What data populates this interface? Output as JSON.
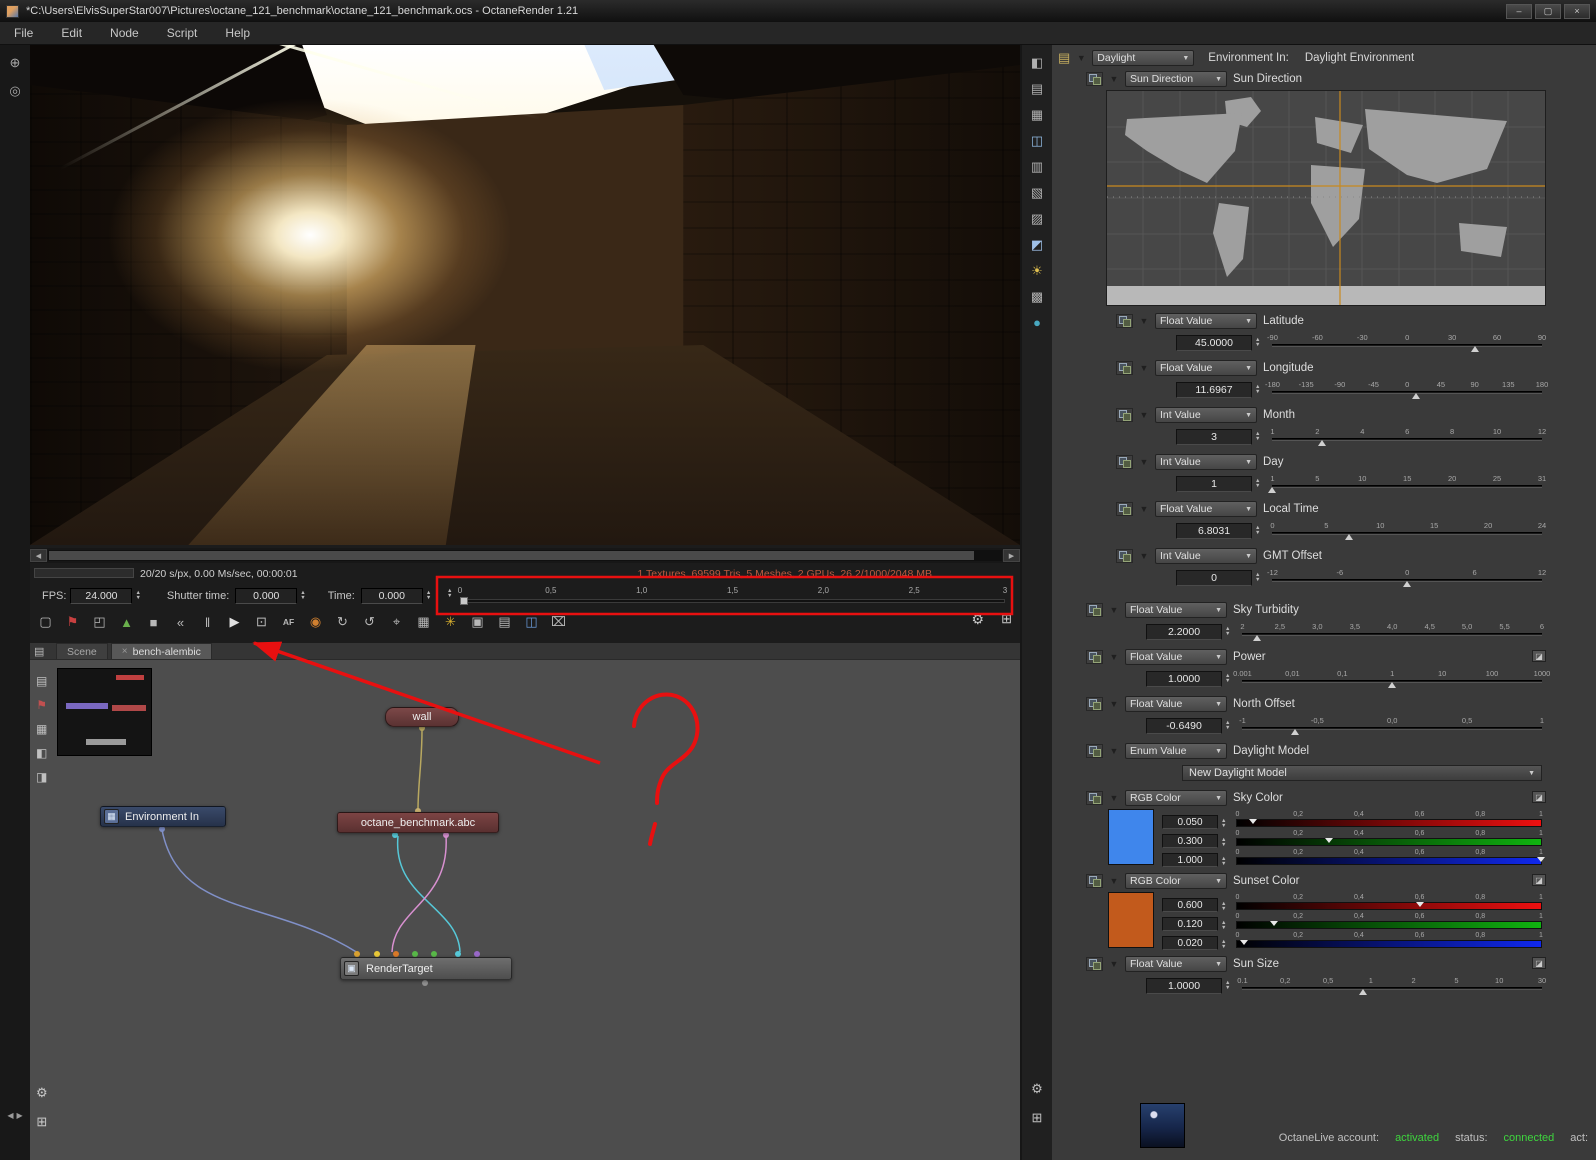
{
  "window": {
    "title": "*C:\\Users\\ElvisSuperStar007\\Pictures\\octane_121_benchmark\\octane_121_benchmark.ocs - OctaneRender 1.21",
    "buttons": {
      "minimize": "–",
      "maximize": "▢",
      "close": "×"
    },
    "menus": [
      "File",
      "Edit",
      "Node",
      "Script",
      "Help"
    ]
  },
  "left_toolbar": [
    {
      "name": "target-icon",
      "glyph": "⊕"
    },
    {
      "name": "zoom-tool-icon",
      "glyph": "◎"
    }
  ],
  "viewport": {
    "stats_left": "20/20 s/px, 0.00 Ms/sec, 00:00:01",
    "stats_right": "1 Textures, 69599 Tris, 5 Meshes, 2 GPUs, 26.2/1000/2048 MB"
  },
  "playback": {
    "fps_label": "FPS:",
    "fps_value": "24.000",
    "shutter_label": "Shutter time:",
    "shutter_value": "0.000",
    "time_label": "Time:",
    "time_value": "0.000",
    "timeline_ticks": [
      "0",
      "0,5",
      "1,0",
      "1,5",
      "2,0",
      "2,5",
      "3"
    ]
  },
  "toolbar": [
    {
      "name": "save-image-icon",
      "glyph": "▢"
    },
    {
      "name": "language-flag-icon",
      "glyph": "⚑",
      "color": "#c84040"
    },
    {
      "name": "fit-view-icon",
      "glyph": "◰"
    },
    {
      "name": "render-restart-icon",
      "glyph": "▲",
      "color": "#6ab04c"
    },
    {
      "name": "stop-icon",
      "glyph": "■"
    },
    {
      "name": "rewind-icon",
      "glyph": "«"
    },
    {
      "name": "pause-icon",
      "glyph": "‖"
    },
    {
      "name": "play-icon",
      "glyph": "▶",
      "color": "#e0e0e0"
    },
    {
      "name": "display-icon",
      "glyph": "⊡"
    },
    {
      "name": "af-toggle-icon",
      "glyph": "AF",
      "text": true
    },
    {
      "name": "globe-icon",
      "glyph": "◉",
      "color": "#d08030"
    },
    {
      "name": "refresh-icon",
      "glyph": "↻"
    },
    {
      "name": "reset-icon",
      "glyph": "↺"
    },
    {
      "name": "focus-pick-icon",
      "glyph": "⌖"
    },
    {
      "name": "grid-icon",
      "glyph": "▦"
    },
    {
      "name": "effects-icon",
      "glyph": "✳",
      "color": "#d8b030"
    },
    {
      "name": "copy-icon",
      "glyph": "▣"
    },
    {
      "name": "paste-icon",
      "glyph": "▤"
    },
    {
      "name": "image-icon",
      "glyph": "◫",
      "color": "#6a9ad8"
    },
    {
      "name": "delete-icon",
      "glyph": "⌧"
    }
  ],
  "node_graph": {
    "tabs": [
      {
        "label": "Scene"
      },
      {
        "label": "bench-alembic"
      }
    ],
    "side_icons": [
      {
        "name": "overview-icon",
        "glyph": "▤"
      },
      {
        "name": "flag-icon",
        "glyph": "⚑",
        "color": "#c05050"
      },
      {
        "name": "layers-icon",
        "glyph": "▦"
      },
      {
        "name": "group-icon",
        "glyph": "◧"
      },
      {
        "name": "ungroup-icon",
        "glyph": "◨"
      }
    ],
    "nodes": [
      {
        "label": "wall"
      },
      {
        "label": "octane_benchmark.abc"
      },
      {
        "label": "Environment In"
      },
      {
        "label": "RenderTarget"
      }
    ]
  },
  "mid_toolbar": [
    {
      "name": "screenshot-icon",
      "glyph": "◧"
    },
    {
      "name": "clipboard-icon",
      "glyph": "▤"
    },
    {
      "name": "film-icon",
      "glyph": "▦"
    },
    {
      "name": "gallery-icon",
      "glyph": "◫",
      "color": "#8fb8e0"
    },
    {
      "name": "mesh-icon",
      "glyph": "▥"
    },
    {
      "name": "materials-icon",
      "glyph": "▧"
    },
    {
      "name": "texture-icon",
      "glyph": "▨"
    },
    {
      "name": "image-icon",
      "glyph": "◩",
      "color": "#9fc0e8"
    },
    {
      "name": "environment-icon",
      "glyph": "☀",
      "color": "#e0c050"
    },
    {
      "name": "checker-icon",
      "glyph": "▩"
    },
    {
      "name": "paint-icon",
      "glyph": "●",
      "color": "#48a8c0"
    }
  ],
  "right_panel": {
    "header": {
      "dropdown": "Daylight",
      "env_label": "Environment In:",
      "env_value": "Daylight Environment"
    },
    "sun_direction": {
      "dropdown": "Sun Direction",
      "label": "Sun Direction"
    },
    "params": [
      {
        "kind": "float",
        "type_label": "Float Value",
        "label": "Latitude",
        "value": "45.0000",
        "indent": true,
        "pos": 0.75,
        "ticks": [
          "-90",
          "-60",
          "-30",
          "0",
          "30",
          "60",
          "90"
        ]
      },
      {
        "kind": "float",
        "type_label": "Float Value",
        "label": "Longitude",
        "value": "11.6967",
        "indent": true,
        "pos": 0.533,
        "ticks": [
          "-180",
          "-135",
          "-90",
          "-45",
          "0",
          "45",
          "90",
          "135",
          "180"
        ]
      },
      {
        "kind": "float",
        "type_label": "Int Value",
        "label": "Month",
        "value": "3",
        "indent": true,
        "pos": 0.182,
        "ticks": [
          "1",
          "2",
          "4",
          "6",
          "8",
          "10",
          "12"
        ]
      },
      {
        "kind": "float",
        "type_label": "Int Value",
        "label": "Day",
        "value": "1",
        "indent": true,
        "pos": 0.0,
        "ticks": [
          "1",
          "5",
          "10",
          "15",
          "20",
          "25",
          "31"
        ]
      },
      {
        "kind": "float",
        "type_label": "Float Value",
        "label": "Local Time",
        "value": "6.8031",
        "indent": true,
        "pos": 0.283,
        "ticks": [
          "0",
          "5",
          "10",
          "15",
          "20",
          "24"
        ]
      },
      {
        "kind": "float",
        "type_label": "Int Value",
        "label": "GMT Offset",
        "value": "0",
        "indent": true,
        "pos": 0.5,
        "gap_after": true,
        "ticks": [
          "-12",
          "-6",
          "0",
          "6",
          "12"
        ]
      },
      {
        "kind": "float",
        "type_label": "Float Value",
        "label": "Sky Turbidity",
        "value": "2.2000",
        "pos": 0.05,
        "ticks": [
          "2",
          "2,5",
          "3,0",
          "3,5",
          "4,0",
          "4,5",
          "5,0",
          "5,5",
          "6"
        ]
      },
      {
        "kind": "float",
        "type_label": "Float Value",
        "label": "Power",
        "value": "1.0000",
        "pos": 0.5,
        "right_icon": true,
        "ticks": [
          "0.001",
          "0,01",
          "0,1",
          "1",
          "10",
          "100",
          "1000"
        ]
      },
      {
        "kind": "float",
        "type_label": "Float Value",
        "label": "North Offset",
        "value": "-0.6490",
        "pos": 0.176,
        "ticks": [
          "-1",
          "-0,5",
          "0,0",
          "0,5",
          "1"
        ]
      },
      {
        "kind": "enum",
        "type_label": "Enum Value",
        "label": "Daylight Model",
        "value": "New Daylight Model"
      },
      {
        "kind": "rgb",
        "type_label": "RGB Color",
        "label": "Sky Color",
        "swatch": "#3f86ec",
        "right_icon": true,
        "ticks": [
          "0",
          "0,2",
          "0,4",
          "0,6",
          "0,8",
          "1"
        ],
        "channels": [
          {
            "value": "0.050",
            "pos": 0.05
          },
          {
            "value": "0.300",
            "pos": 0.3
          },
          {
            "value": "1.000",
            "pos": 1.0
          }
        ]
      },
      {
        "kind": "rgb",
        "type_label": "RGB Color",
        "label": "Sunset Color",
        "swatch": "#c25a1c",
        "right_icon": true,
        "ticks": [
          "0",
          "0,2",
          "0,4",
          "0,6",
          "0,8",
          "1"
        ],
        "channels": [
          {
            "value": "0.600",
            "pos": 0.6
          },
          {
            "value": "0.120",
            "pos": 0.12
          },
          {
            "value": "0.020",
            "pos": 0.02
          }
        ]
      },
      {
        "kind": "float",
        "type_label": "Float Value",
        "label": "Sun Size",
        "value": "1.0000",
        "pos": 0.404,
        "right_icon": true,
        "ticks": [
          "0.1",
          "0,2",
          "0,5",
          "1",
          "2",
          "5",
          "10",
          "30"
        ]
      }
    ]
  },
  "status_bar": {
    "account_label": "OctaneLive account:",
    "account_value": "activated",
    "status_label": "status:",
    "status_value": "connected",
    "act_label": "act:"
  },
  "colors": {
    "accent_green": "#3ed63e",
    "annotation_red": "#e81010",
    "stats_red": "#bc5a40"
  }
}
